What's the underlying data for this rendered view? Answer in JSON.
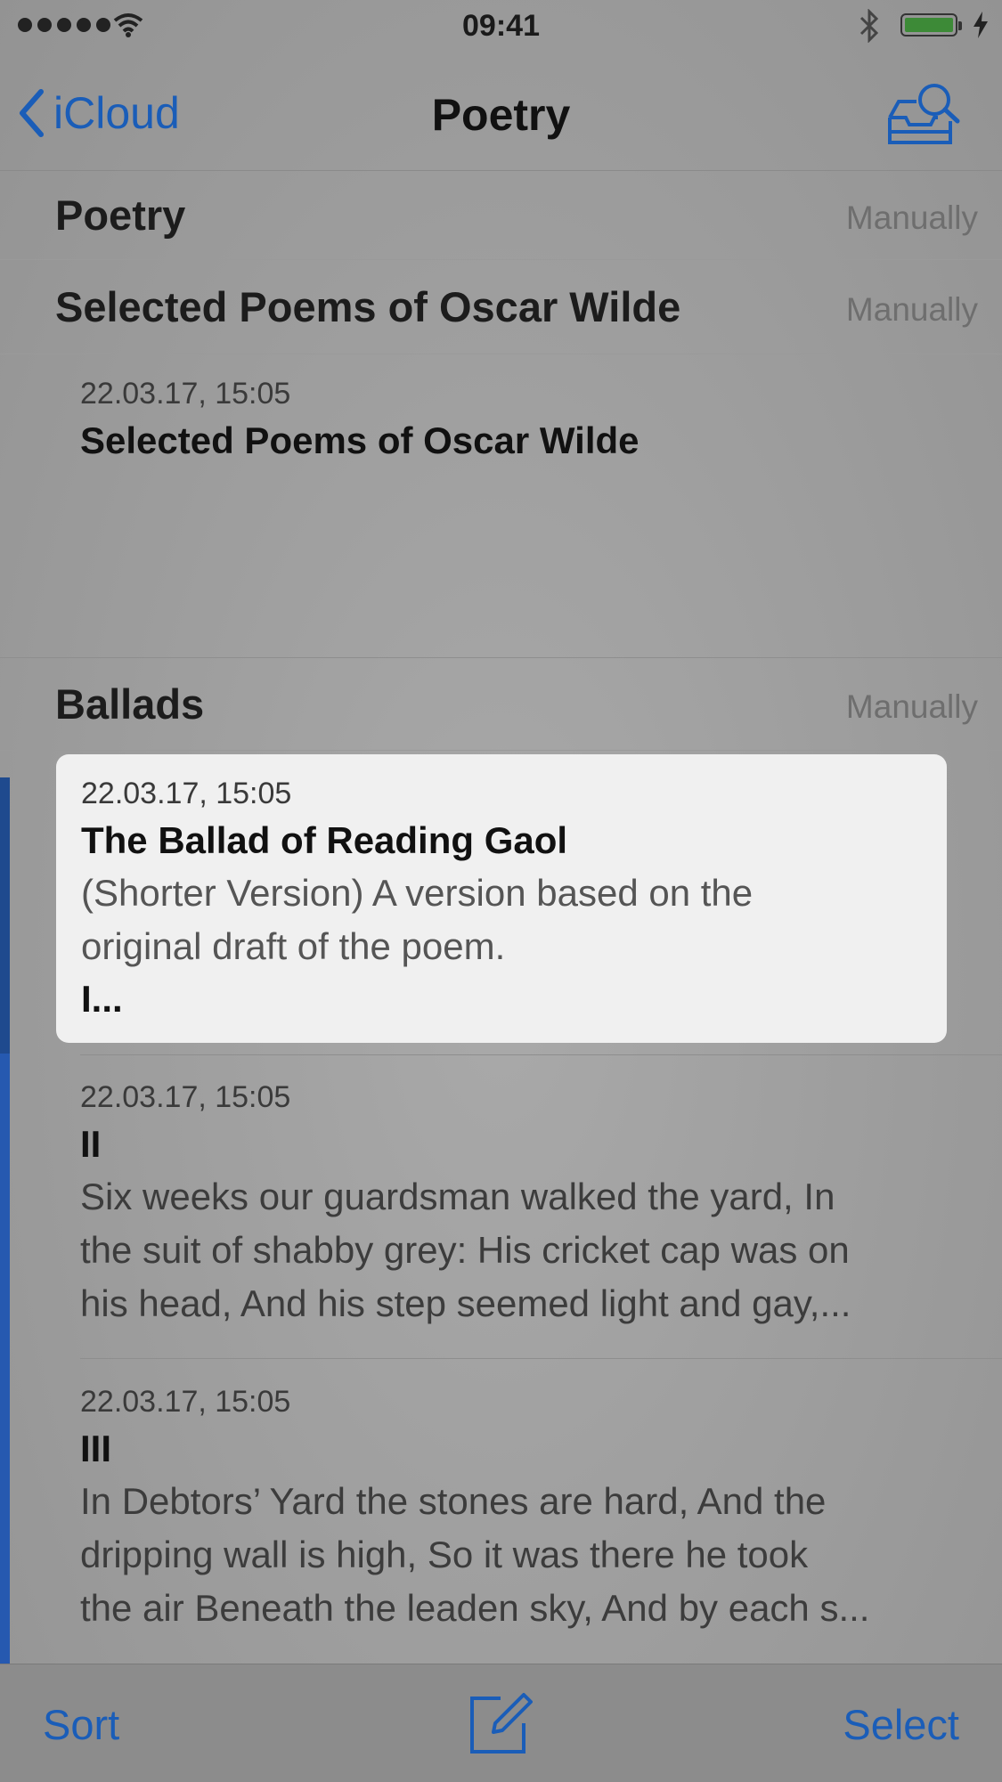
{
  "status_bar": {
    "time": "09:41"
  },
  "nav": {
    "back_label": "iCloud",
    "title": "Poetry"
  },
  "sections": [
    {
      "title": "Poetry",
      "sort": "Manually"
    },
    {
      "title": "Selected Poems of Oscar Wilde",
      "sort": "Manually"
    },
    {
      "title": "Ballads",
      "sort": "Manually"
    }
  ],
  "notes": [
    {
      "date": "22.03.17, 15:05",
      "title": "Selected Poems of Oscar Wilde"
    },
    {
      "date": "22.03.17, 15:05",
      "title": "The Ballad of Reading Gaol",
      "body": [
        "(Shorter Version) A version based on the",
        "original draft of the poem."
      ],
      "extra": "I..."
    },
    {
      "date": "22.03.17, 15:05",
      "title": "II",
      "body": [
        "Six weeks our guardsman walked the yard, In",
        "the suit of shabby grey: His cricket cap was on",
        "his head, And his step seemed light and gay,..."
      ]
    },
    {
      "date": "22.03.17, 15:05",
      "title": "III",
      "body": [
        "In Debtors’ Yard the stones are hard, And the",
        "dripping wall is high, So it was there he took",
        "the air Beneath the leaden sky, And by each s..."
      ]
    }
  ],
  "toolbar": {
    "sort_label": "Sort",
    "select_label": "Select"
  },
  "colors": {
    "accent": "#1a5db8",
    "selection_bar": "#1f4f9a",
    "battery": "#3d8a37"
  },
  "icons": [
    "signal-dots-icon",
    "wifi-icon",
    "bluetooth-icon",
    "battery-icon",
    "charging-bolt-icon",
    "chevron-left-icon",
    "search-inbox-icon",
    "compose-icon"
  ]
}
